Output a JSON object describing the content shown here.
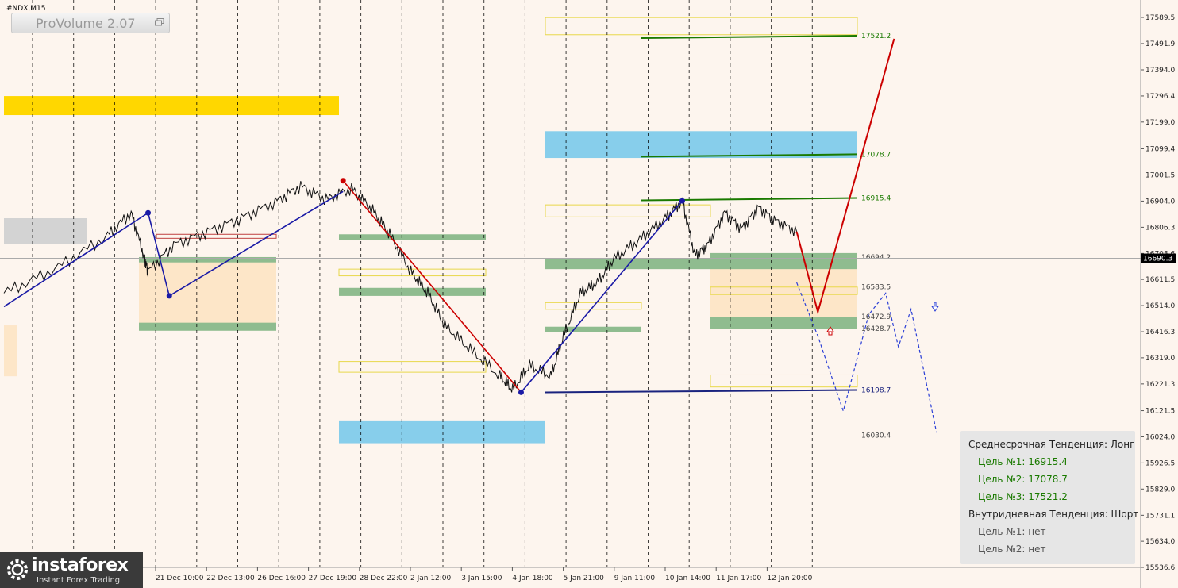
{
  "window": {
    "symbol": "#NDX,M15"
  },
  "indicator": {
    "name": "ProVolume 2.07"
  },
  "chart_data": {
    "type": "line",
    "title": "",
    "y_axis_side": "right",
    "ylim": [
      15536.6,
      17589.5
    ],
    "yticks": [
      17589.5,
      17491.9,
      17394.0,
      17296.4,
      17199.0,
      17099.4,
      17001.5,
      16904.0,
      16806.3,
      16708.6,
      16611.5,
      16514.0,
      16416.3,
      16319.0,
      16221.3,
      16121.5,
      16024.0,
      15926.5,
      15829.0,
      15731.1,
      15634.0,
      15536.6
    ],
    "current_price": 16690.3,
    "xticks": [
      "21 Dec 10:00",
      "22 Dec 13:00",
      "26 Dec 16:00",
      "27 Dec 19:00",
      "28 Dec 22:00",
      "2 Jan 12:00",
      "3 Jan 15:00",
      "4 Jan 18:00",
      "5 Jan 21:00",
      "9 Jan 11:00",
      "10 Jan 14:00",
      "11 Jan 17:00",
      "12 Jan 20:00"
    ],
    "levels": [
      {
        "value": 17521.2,
        "label": "17521.2",
        "color": "#1a7a00"
      },
      {
        "value": 17078.7,
        "label": "17078.7",
        "color": "#1a7a00"
      },
      {
        "value": 16915.4,
        "label": "16915.4",
        "color": "#1a7a00"
      },
      {
        "value": 16694.2,
        "label": "16694.2",
        "color": "#444444"
      },
      {
        "value": 16583.5,
        "label": "16583.5",
        "color": "#444444"
      },
      {
        "value": 16472.9,
        "label": "16472.9",
        "color": "#444444"
      },
      {
        "value": 16428.7,
        "label": "16428.7",
        "color": "#444444"
      },
      {
        "value": 16198.7,
        "label": "16198.7",
        "color": "#1a237e"
      },
      {
        "value": 16030.4,
        "label": "16030.4",
        "color": "#444444"
      }
    ],
    "price_path": [
      [
        0.0,
        16560
      ],
      [
        0.06,
        16650
      ],
      [
        0.12,
        16770
      ],
      [
        0.15,
        16860
      ],
      [
        0.165,
        16700
      ],
      [
        0.17,
        16640
      ],
      [
        0.2,
        16740
      ],
      [
        0.24,
        16790
      ],
      [
        0.28,
        16840
      ],
      [
        0.32,
        16900
      ],
      [
        0.35,
        16960
      ],
      [
        0.38,
        16910
      ],
      [
        0.41,
        16950
      ],
      [
        0.435,
        16870
      ],
      [
        0.455,
        16780
      ],
      [
        0.48,
        16640
      ],
      [
        0.5,
        16560
      ],
      [
        0.52,
        16440
      ],
      [
        0.55,
        16350
      ],
      [
        0.585,
        16250
      ],
      [
        0.6,
        16200
      ],
      [
        0.62,
        16290
      ],
      [
        0.645,
        16250
      ],
      [
        0.66,
        16400
      ],
      [
        0.68,
        16560
      ],
      [
        0.7,
        16600
      ],
      [
        0.72,
        16690
      ],
      [
        0.75,
        16760
      ],
      [
        0.78,
        16840
      ],
      [
        0.8,
        16905
      ],
      [
        0.815,
        16700
      ],
      [
        0.83,
        16740
      ],
      [
        0.85,
        16860
      ],
      [
        0.87,
        16800
      ],
      [
        0.89,
        16880
      ],
      [
        0.91,
        16830
      ],
      [
        0.935,
        16790
      ]
    ],
    "zigzag_blue": [
      [
        0.0,
        16510
      ],
      [
        0.17,
        16860
      ],
      [
        0.195,
        16550
      ],
      [
        0.4,
        16940
      ]
    ],
    "zigzag_red": [
      [
        0.4,
        16980
      ],
      [
        0.61,
        16190
      ]
    ],
    "zigzag_blue2": [
      [
        0.61,
        16190
      ],
      [
        0.8,
        16905
      ]
    ],
    "forecast_red": [
      [
        0.935,
        16790
      ],
      [
        0.96,
        16490
      ],
      [
        1.05,
        17510
      ]
    ],
    "forecast_dashed": [
      [
        0.935,
        16600
      ],
      [
        0.96,
        16400
      ],
      [
        0.99,
        16120
      ],
      [
        1.02,
        16480
      ],
      [
        1.04,
        16560
      ],
      [
        1.055,
        16360
      ],
      [
        1.07,
        16500
      ],
      [
        1.1,
        16040
      ]
    ]
  },
  "zones": {
    "gold_band": {
      "lo": 17225,
      "hi": 17296
    },
    "gray_box": {
      "lo": 16745,
      "hi": 16840
    },
    "blue_top": {
      "lo": 17065,
      "hi": 17165
    },
    "blue_bottom": {
      "lo": 16000,
      "hi": 16085
    },
    "yellow_top": {
      "lo": 17525,
      "hi": 17589
    },
    "beige_right": {
      "lo": 16428,
      "hi": 16694
    },
    "beige_left": {
      "lo": 16440,
      "hi": 16680
    }
  },
  "colors": {
    "accent_green": "#1a7a00",
    "accent_red": "#cc0000",
    "accent_blue": "#1a1aa6",
    "gold": "#ffd700",
    "sky": "#87ceeb",
    "zone_green": "#8fbc8f",
    "beige": "#fde6c8"
  },
  "infobox": {
    "medium_trend": "Среднесрочная Тенденция: Лонг",
    "target1": "Цель №1: 16915.4",
    "target2": "Цель №2: 17078.7",
    "target3": "Цель №3: 17521.2",
    "intraday_trend": "Внутридневная Тенденция: Шорт",
    "intraday_target1": "Цель №1: нет",
    "intraday_target2": "Цель №2: нет"
  },
  "logo": {
    "brand": "instaforex",
    "tagline": "Instant Forex Trading"
  }
}
